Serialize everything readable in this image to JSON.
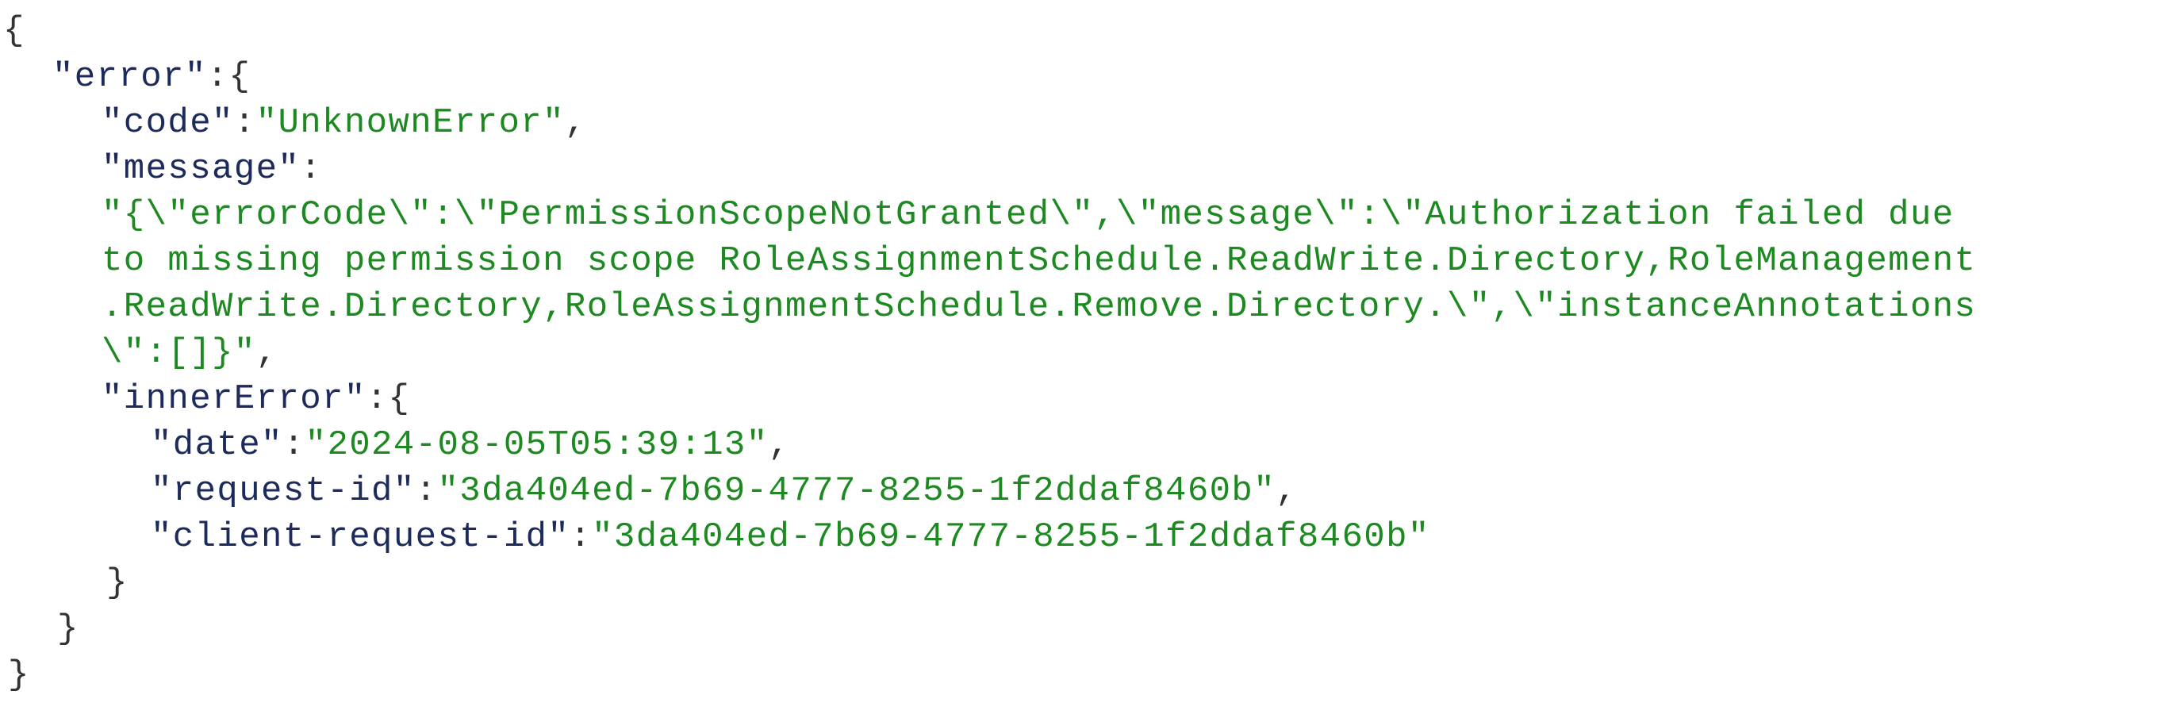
{
  "json_view": {
    "root_open": "{",
    "error_key": "\"error\"",
    "code_key": "\"code\"",
    "code_value": "\"UnknownError\"",
    "message_key": "\"message\"",
    "message_line_1": "\"{\\\"errorCode\\\":\\\"PermissionScopeNotGranted\\\",\\\"message\\\":\\\"Authorization failed due",
    "message_line_2": "to missing permission scope RoleAssignmentSchedule.ReadWrite.Directory,RoleManagement",
    "message_line_3": ".ReadWrite.Directory,RoleAssignmentSchedule.Remove.Directory.\\\",\\\"instanceAnnotations",
    "message_line_4": "\\\":[]}\"",
    "inner_error_key": "\"innerError\"",
    "date_key": "\"date\"",
    "date_value": "\"2024-08-05T05:39:13\"",
    "request_id_key": "\"request-id\"",
    "request_id_value": "\"3da404ed-7b69-4777-8255-1f2ddaf8460b\"",
    "client_request_id_key": "\"client-request-id\"",
    "client_request_id_value": "\"3da404ed-7b69-4777-8255-1f2ddaf8460b\"",
    "inner_error_close": "}",
    "error_close": "}",
    "root_close": "}"
  }
}
